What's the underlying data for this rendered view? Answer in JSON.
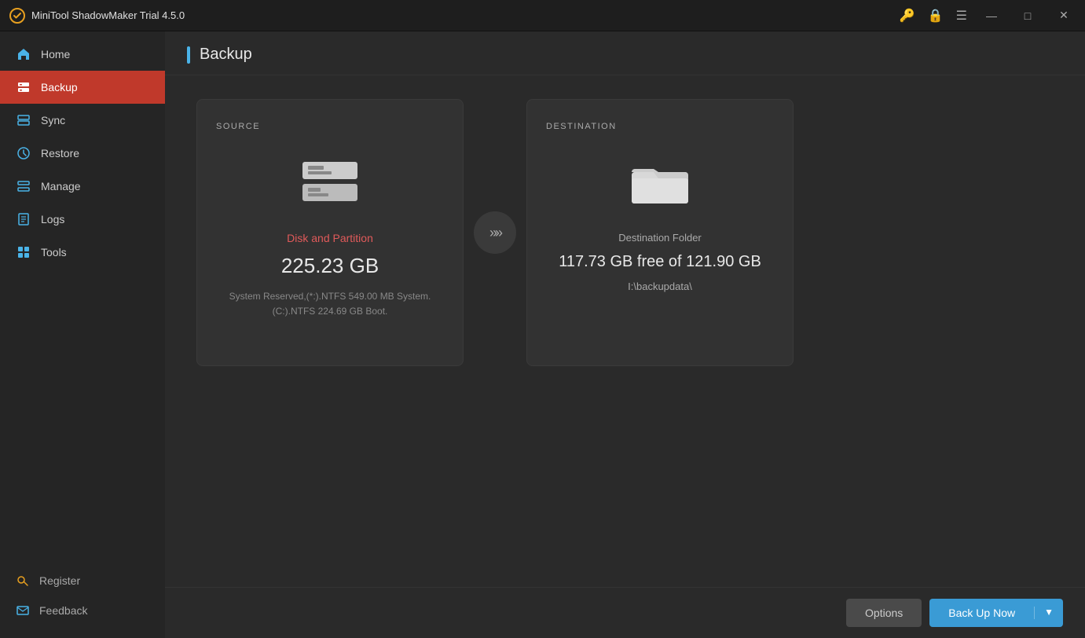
{
  "titleBar": {
    "title": "MiniTool ShadowMaker Trial 4.5.0"
  },
  "sidebar": {
    "items": [
      {
        "id": "home",
        "label": "Home",
        "icon": "home"
      },
      {
        "id": "backup",
        "label": "Backup",
        "icon": "backup",
        "active": true
      },
      {
        "id": "sync",
        "label": "Sync",
        "icon": "sync"
      },
      {
        "id": "restore",
        "label": "Restore",
        "icon": "restore"
      },
      {
        "id": "manage",
        "label": "Manage",
        "icon": "manage"
      },
      {
        "id": "logs",
        "label": "Logs",
        "icon": "logs"
      },
      {
        "id": "tools",
        "label": "Tools",
        "icon": "tools"
      }
    ],
    "bottomItems": [
      {
        "id": "register",
        "label": "Register",
        "icon": "key"
      },
      {
        "id": "feedback",
        "label": "Feedback",
        "icon": "mail"
      }
    ]
  },
  "page": {
    "title": "Backup"
  },
  "source": {
    "label": "SOURCE",
    "typeLabel": "Disk and Partition",
    "size": "225.23 GB",
    "description": "System Reserved,(*:).NTFS 549.00 MB System.\n(C:).NTFS 224.69 GB Boot."
  },
  "destination": {
    "label": "DESTINATION",
    "typeLabel": "Destination Folder",
    "freeSpace": "117.73 GB free of 121.90 GB",
    "path": "I:\\backupdata\\"
  },
  "buttons": {
    "options": "Options",
    "backupNow": "Back Up Now"
  }
}
